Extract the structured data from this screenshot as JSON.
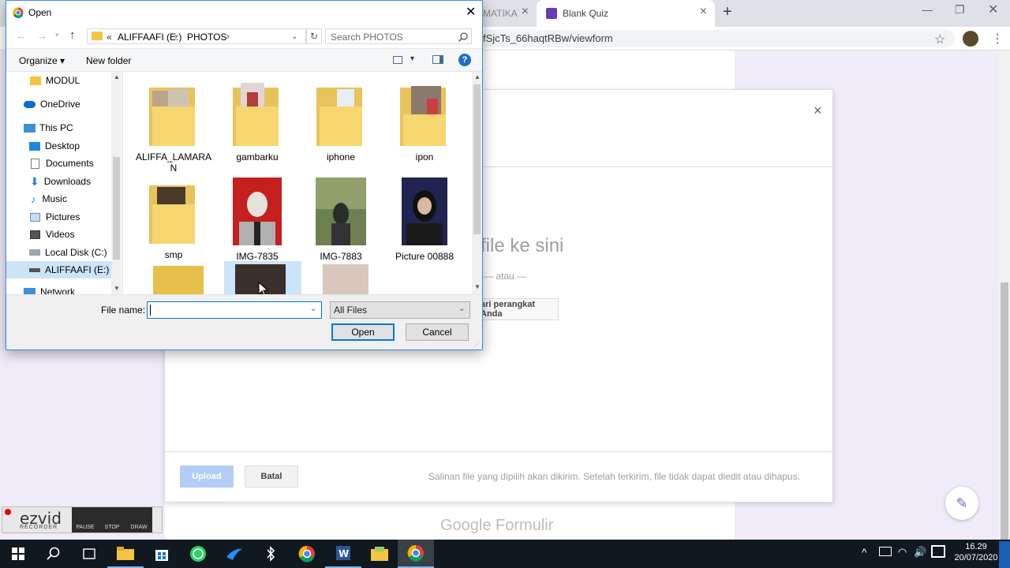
{
  "browser": {
    "tab_partial": "MATIKA",
    "tab_active": "Blank Quiz",
    "url_partial": "fSjcTs_66haqtRBw/viewform"
  },
  "form_modal": {
    "drop_text": "file ke sini",
    "or_text": "— atau —",
    "browse_button": "ari perangkat Anda",
    "upload_button": "Upload",
    "cancel_button": "Batal",
    "notice": "Salinan file yang dipilih akan dikirim. Setelah terkirim, file tidak dapat diedit atau dihapus.",
    "footer_brand": "Google Formulir"
  },
  "recorder": {
    "brand": "ezvid",
    "sub": "RECORDER",
    "pause": "PAUSE",
    "stop": "STOP",
    "draw": "DRAW"
  },
  "dialog": {
    "title": "Open",
    "breadcrumb": [
      "«",
      "ALIFFAAFI (E:)",
      "PHOTOS"
    ],
    "search_placeholder": "Search PHOTOS",
    "organize": "Organize ▾",
    "new_folder": "New folder",
    "nav": [
      {
        "label": "MODUL",
        "icon": "folder-icon"
      },
      {
        "label": "OneDrive",
        "icon": "cloud-icon"
      },
      {
        "label": "This PC",
        "icon": "computer-icon"
      },
      {
        "label": "Desktop",
        "icon": "desktop-icon"
      },
      {
        "label": "Documents",
        "icon": "documents-icon"
      },
      {
        "label": "Downloads",
        "icon": "download-icon"
      },
      {
        "label": "Music",
        "icon": "music-icon"
      },
      {
        "label": "Pictures",
        "icon": "pictures-icon"
      },
      {
        "label": "Videos",
        "icon": "videos-icon"
      },
      {
        "label": "Local Disk (C:)",
        "icon": "disk-icon"
      },
      {
        "label": "ALIFFAAFI (E:)",
        "icon": "usb-drive-icon"
      },
      {
        "label": "Network",
        "icon": "network-icon"
      }
    ],
    "items": [
      {
        "label": "ALIFFA_LAMARAN",
        "kind": "folder"
      },
      {
        "label": "gambarku",
        "kind": "folder"
      },
      {
        "label": "iphone",
        "kind": "folder"
      },
      {
        "label": "ipon",
        "kind": "folder"
      },
      {
        "label": "smp",
        "kind": "folder"
      },
      {
        "label": "IMG-7835",
        "kind": "photo"
      },
      {
        "label": "IMG-7883",
        "kind": "photo"
      },
      {
        "label": "Picture 00888",
        "kind": "photo"
      }
    ],
    "file_name_label": "File name:",
    "file_name_value": "",
    "file_type": "All Files",
    "open_button": "Open",
    "cancel_button": "Cancel"
  },
  "taskbar": {
    "time": "16.29",
    "date": "20/07/2020"
  }
}
